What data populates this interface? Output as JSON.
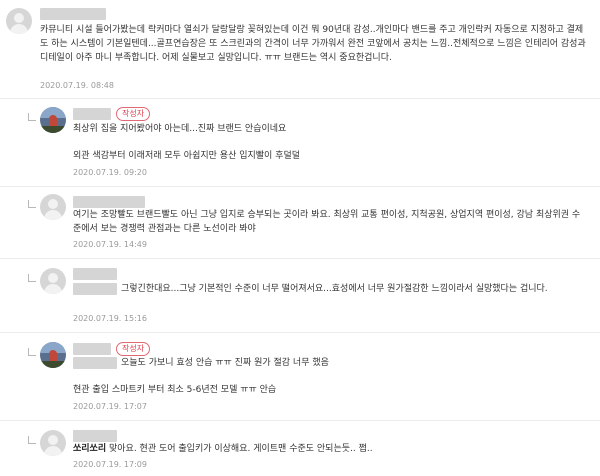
{
  "comments": [
    {
      "id": "c1",
      "text": "카뮤니티 시설 들어가봤는데 락커마다 열쇠가 달랑달랑 꽂혀있는데 이건 뭐 90년대 감성..개인마다 밴드를 주고 개인락커 자동으로 지정하고 결제도 하는 시스템이 기본일텐데...골프연습장은 또 스크린과의 간격이 너무 가까워서 완전 코앞에서 공치는 느낌..전체적으로 느낌은 인테리어 감성과 디테일이 아주 마니 부족합니다. 어제 실물보고 실망입니다. ㅠㅠ 브랜드는 역시 중요한겁니다.",
      "date": "2020.07.19. 08:48"
    },
    {
      "id": "c2",
      "badge": "작성자",
      "lines": [
        "최상위 집을 지어봤어야 아는데...진짜 브랜드 안습이네요",
        "외관 색감부터 이래저래 모두 아쉽지만 용산 입지빨이 후덜덜"
      ],
      "date": "2020.07.19. 09:20"
    },
    {
      "id": "c3",
      "text": "여기는 조망빨도 브랜드빨도 아닌 그냥 입지로 승부되는 곳이라 봐요. 최상위 교통 편이성, 지척공원, 상업지역 편이성, 강남 최상위권 수준에서 보는 경쟁력 관점과는 다른 노선이라 봐야",
      "date": "2020.07.19. 14:49"
    },
    {
      "id": "c4",
      "text": "그렇긴한대요...그냥 기본적인 수준이 너무 떨어져서요...효성에서 너무 원가절감한 느낌이라서 실망했다는 겁니다.",
      "date": "2020.07.19. 15:16"
    },
    {
      "id": "c5",
      "badge": "작성자",
      "lines": [
        "오늘도 가보니 효성 안습 ㅠㅠ 진짜 원가 절감 너무 했음",
        "현관 출입 스마트키 부터 최소 5-6년전 모델 ㅠㅠ 안습"
      ],
      "date": "2020.07.19. 17:07"
    },
    {
      "id": "c6",
      "mention": "쏘리쏘리",
      "text": " 맞아요. 현관 도어 출입키가 이상해요. 게이트맨 수준도 안되는듯.. 쩝..",
      "date": "2020.07.19. 17:09"
    }
  ]
}
